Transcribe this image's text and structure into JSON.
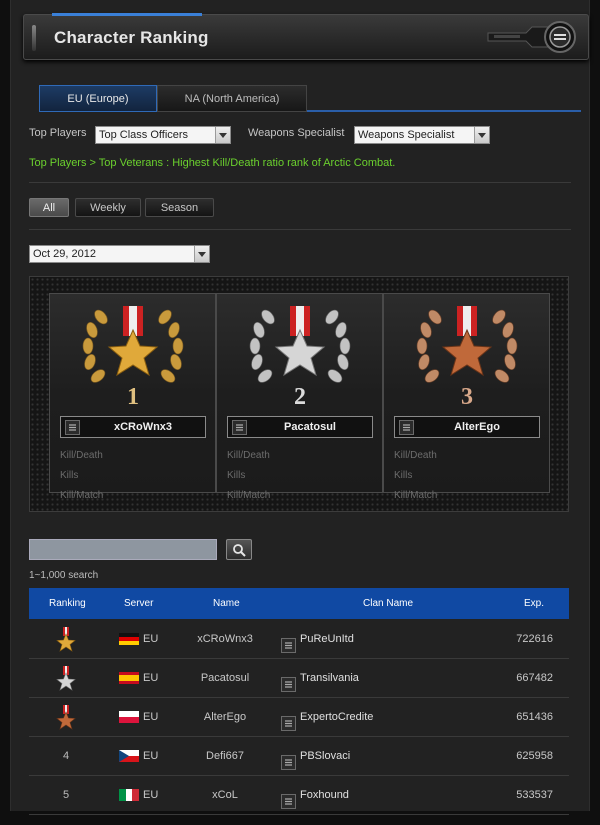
{
  "header": {
    "title": "Character Ranking"
  },
  "regions": [
    "EU (Europe)",
    "NA (North America)"
  ],
  "filters": {
    "top_players_label": "Top Players",
    "top_players_value": "Top Class Officers",
    "weapons_label": "Weapons Specialist",
    "weapons_value": "Weapons Specialist"
  },
  "breadcrumb": "Top Players > Top Veterans : Highest Kill/Death ratio rank of Arctic Combat.",
  "periods": [
    "All",
    "Weekly",
    "Season"
  ],
  "date": "Oct 29, 2012",
  "podium": [
    {
      "rank": "1",
      "name": "xCRoWnx3",
      "stats": [
        "Kill/Death",
        "Kills",
        "Kill/Match"
      ]
    },
    {
      "rank": "2",
      "name": "Pacatosul",
      "stats": [
        "Kill/Death",
        "Kills",
        "Kill/Match"
      ]
    },
    {
      "rank": "3",
      "name": "AlterEgo",
      "stats": [
        "Kill/Death",
        "Kills",
        "Kill/Match"
      ]
    }
  ],
  "search": {
    "placeholder": "",
    "hint": "1~1,000 search"
  },
  "table": {
    "headers": [
      "Ranking",
      "Server",
      "Name",
      "Clan Name",
      "Exp."
    ],
    "rows": [
      {
        "rank": "",
        "flag": "germany",
        "server": "EU",
        "name": "xCRoWnx3",
        "clan": "PuReUnItd",
        "exp": "722616"
      },
      {
        "rank": "",
        "flag": "spain",
        "server": "EU",
        "name": "Pacatosul",
        "clan": "Transilvania",
        "exp": "667482"
      },
      {
        "rank": "",
        "flag": "poland",
        "server": "EU",
        "name": "AlterEgo",
        "clan": "ExpertoCredite",
        "exp": "651436"
      },
      {
        "rank": "4",
        "flag": "czech",
        "server": "EU",
        "name": "Defi667",
        "clan": "PBSlovaci",
        "exp": "625958"
      },
      {
        "rank": "5",
        "flag": "italy",
        "server": "EU",
        "name": "xCoL",
        "clan": "Foxhound",
        "exp": "533537"
      }
    ]
  },
  "colors": {
    "accent_blue": "#1049a3",
    "breadcrumb_green": "#6bd12e",
    "gold": "#d9a53a",
    "silver": "#c9c9c9",
    "bronze": "#c07a4a"
  },
  "icons": [
    "clan-mark-icon",
    "search-icon",
    "medal-icon",
    "laurel-icon",
    "dropdown-arrow-icon"
  ]
}
